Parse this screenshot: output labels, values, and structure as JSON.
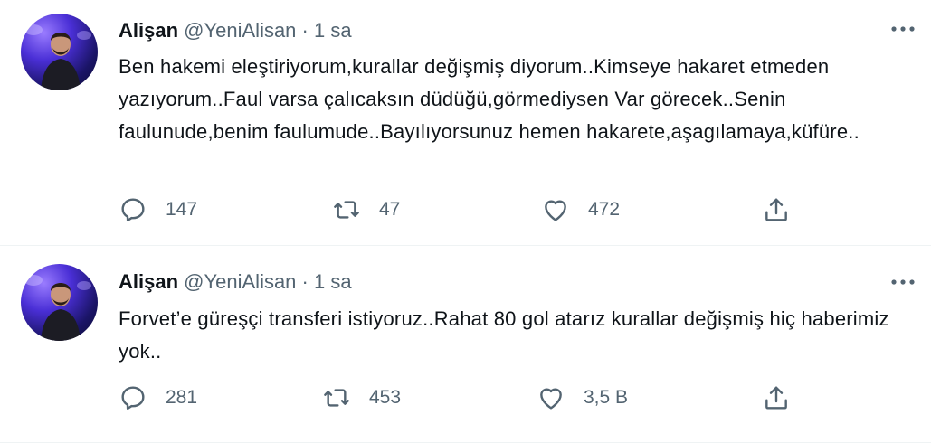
{
  "tweets": [
    {
      "name": "Alişan",
      "handle": "@YeniAlisan",
      "separator": "·",
      "time": "1 sa",
      "text": "Ben hakemi eleştiriyorum,kurallar değişmiş diyorum..Kimseye hakaret etmeden yazıyorum..Faul varsa çalıcaksın düdüğü,görmediysen Var görecek..Senin faulunude,benim faulumude..Bayılıyorsunuz hemen hakarete,aşagılamaya,küfüre..",
      "replies": "147",
      "retweets": "47",
      "likes": "472"
    },
    {
      "name": "Alişan",
      "handle": "@YeniAlisan",
      "separator": "·",
      "time": "1 sa",
      "text": "Forvet’e güreşçi transferi istiyoruz..Rahat 80 gol atarız kurallar değişmiş hiç haberimiz yok..",
      "replies": "281",
      "retweets": "453",
      "likes": "3,5 B"
    }
  ],
  "icons": {
    "reply": "reply-icon",
    "retweet": "retweet-icon",
    "like": "heart-icon",
    "share": "share-icon",
    "more": "more-icon"
  },
  "colors": {
    "text": "#0f1419",
    "secondary": "#536471",
    "divider": "#eff3f4"
  }
}
